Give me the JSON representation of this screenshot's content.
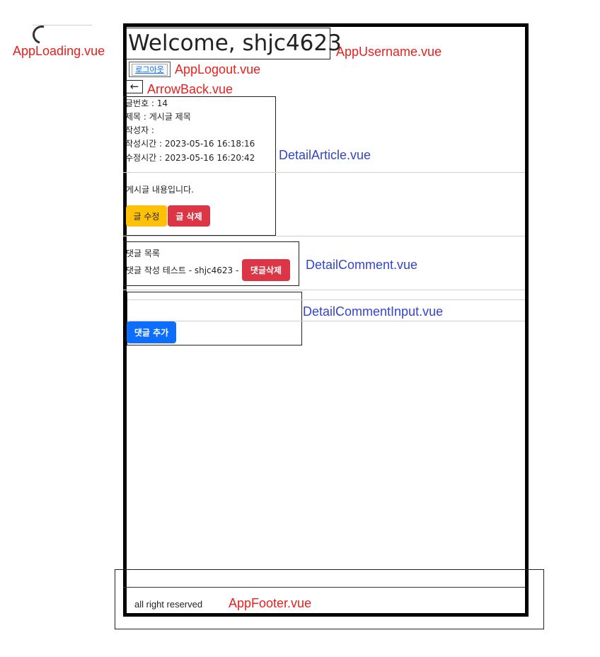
{
  "loading": {
    "label": "AppLoading.vue"
  },
  "username": {
    "welcome": "Welcome, shjc4623",
    "label": "AppUsername.vue"
  },
  "logout": {
    "button": "로그아웃",
    "label": "AppLogout.vue"
  },
  "arrow_back": {
    "icon": "left-arrow-icon",
    "glyph": "←",
    "label": "ArrowBack.vue"
  },
  "article": {
    "label": "DetailArticle.vue",
    "number": "글번호 : 14",
    "title": "제목 : 게시글 제목",
    "author": "작성자 :",
    "created": "작성시간 : 2023-05-16 16:18:16",
    "updated": "수정시간 : 2023-05-16 16:20:42",
    "content": "게시글 내용입니다.",
    "edit_button": "글 수정",
    "delete_button": "글 삭제",
    "colors": {
      "edit": "#ffc107",
      "delete": "#dc3545"
    }
  },
  "comments": {
    "label": "DetailComment.vue",
    "heading": "댓글 목록",
    "items": [
      {
        "text": "댓글 작성 테스트 - shjc4623 -",
        "delete_button": "댓글삭제"
      }
    ]
  },
  "comment_input": {
    "label": "DetailCommentInput.vue",
    "add_button": "댓글 추가",
    "colors": {
      "add": "#0d6efd"
    }
  },
  "footer": {
    "text": "all right reserved",
    "label": "AppFooter.vue"
  }
}
